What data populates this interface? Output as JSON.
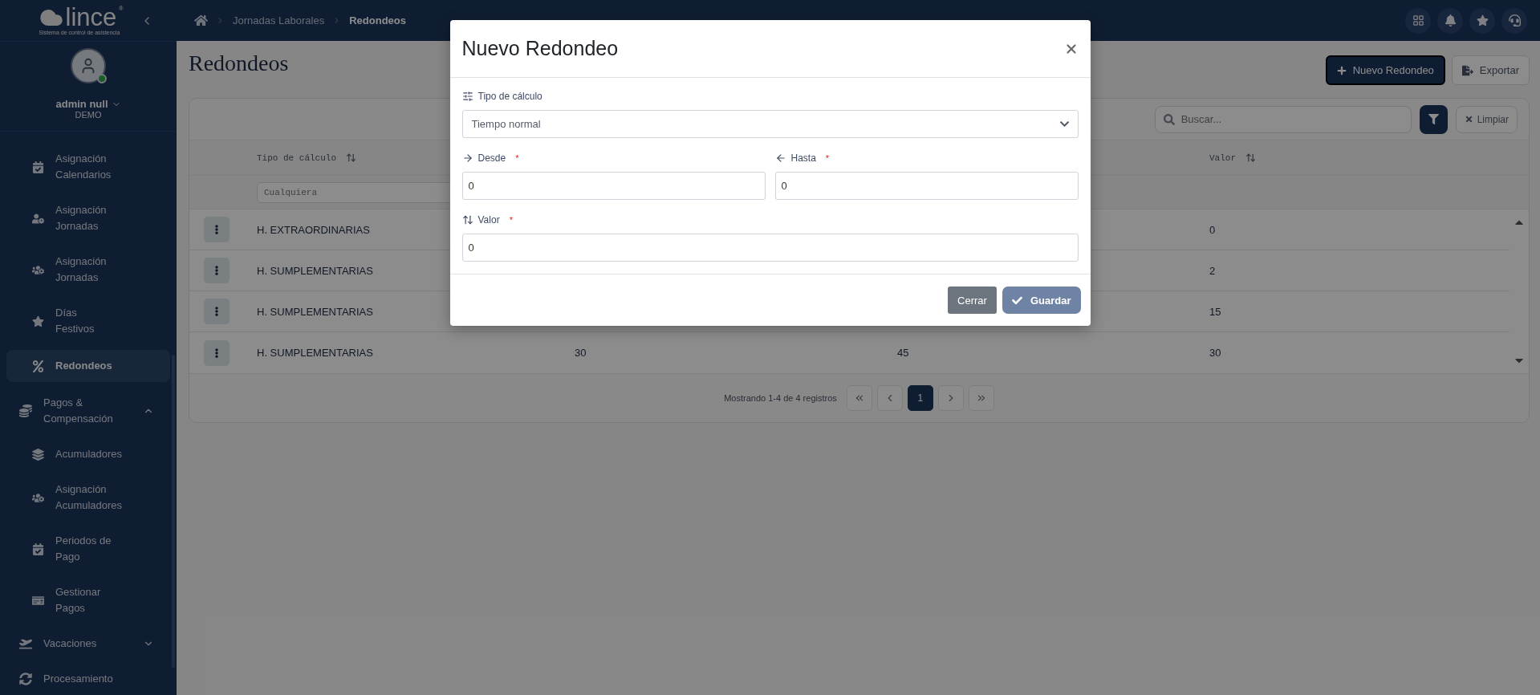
{
  "logo": {
    "name": "lince",
    "mark": "®",
    "tagline": "Sistema de control de asistencia"
  },
  "breadcrumb": [
    {
      "label": "Jornadas Laborales",
      "current": false
    },
    {
      "label": "Redondeos",
      "current": true
    }
  ],
  "user": {
    "name": "admin null",
    "company": "DEMO",
    "online": true
  },
  "sidebar": {
    "menu": [
      {
        "kind": "section",
        "children": [
          {
            "label": "Asignación Calendarios",
            "selected": false
          },
          {
            "label": "Asignación Jornadas",
            "selected": false
          },
          {
            "label": "Asignación Jornadas",
            "selected": false
          },
          {
            "label": "Días\nFestivos",
            "selected": false
          },
          {
            "label": "Redondeos",
            "selected": true
          }
        ]
      },
      {
        "kind": "group",
        "label": "Pagos & Compensación",
        "expanded": true,
        "children": [
          {
            "label": "Acumuladores",
            "selected": false
          },
          {
            "label": "Asignación Acumuladores",
            "selected": false
          },
          {
            "label": "Periodos de Pago",
            "selected": false
          },
          {
            "label": "Gestionar Pagos",
            "selected": false
          }
        ]
      },
      {
        "kind": "group",
        "label": "Vacaciones",
        "expanded": false
      },
      {
        "kind": "item",
        "label": "Procesamiento",
        "selected": false
      }
    ]
  },
  "page": {
    "title": "Redondeos",
    "actions": [
      {
        "label": "Nuevo Redondeo",
        "kind": "primary"
      },
      {
        "label": "Exportar",
        "kind": "outline"
      }
    ]
  },
  "toolbar": {
    "search_placeholder": "Buscar...",
    "clear_label": "Limpiar"
  },
  "table": {
    "columns": [
      {
        "label": "Tipo de cálculo",
        "filter_placeholder": "Cualquiera"
      },
      {},
      {},
      {
        "label": "Valor"
      }
    ],
    "rows": [
      {
        "cells": [
          "H. EXTRAORDINARIAS",
          null,
          null,
          "0"
        ]
      },
      {
        "cells": [
          "H. SUMPLEMENTARIAS",
          null,
          null,
          "2"
        ]
      },
      {
        "cells": [
          "H. SUMPLEMENTARIAS",
          null,
          null,
          "15"
        ]
      },
      {
        "cells": [
          "H. SUMPLEMENTARIAS",
          "30",
          "45",
          "30"
        ]
      }
    ]
  },
  "pagination": {
    "summary": "Mostrando 1-4 de 4 registros",
    "pages": [
      {
        "label": "1",
        "selected": true
      }
    ]
  },
  "modal": {
    "title": "Nuevo Redondeo",
    "fields": [
      {
        "kind": "select",
        "label": "Tipo de cálculo",
        "value": "Tiempo normal"
      },
      {
        "kind": "number",
        "label": "Desde",
        "required_mark": "*",
        "value": "0"
      },
      {
        "kind": "number",
        "label": "Hasta",
        "required_mark": "*",
        "value": "0"
      },
      {
        "kind": "number",
        "label": "Valor",
        "required_mark": "*",
        "value": "0"
      }
    ],
    "buttons": [
      {
        "label": "Cerrar",
        "kind": "secondary",
        "disabled": false
      },
      {
        "label": "Guardar",
        "kind": "primary",
        "disabled": true
      }
    ]
  }
}
